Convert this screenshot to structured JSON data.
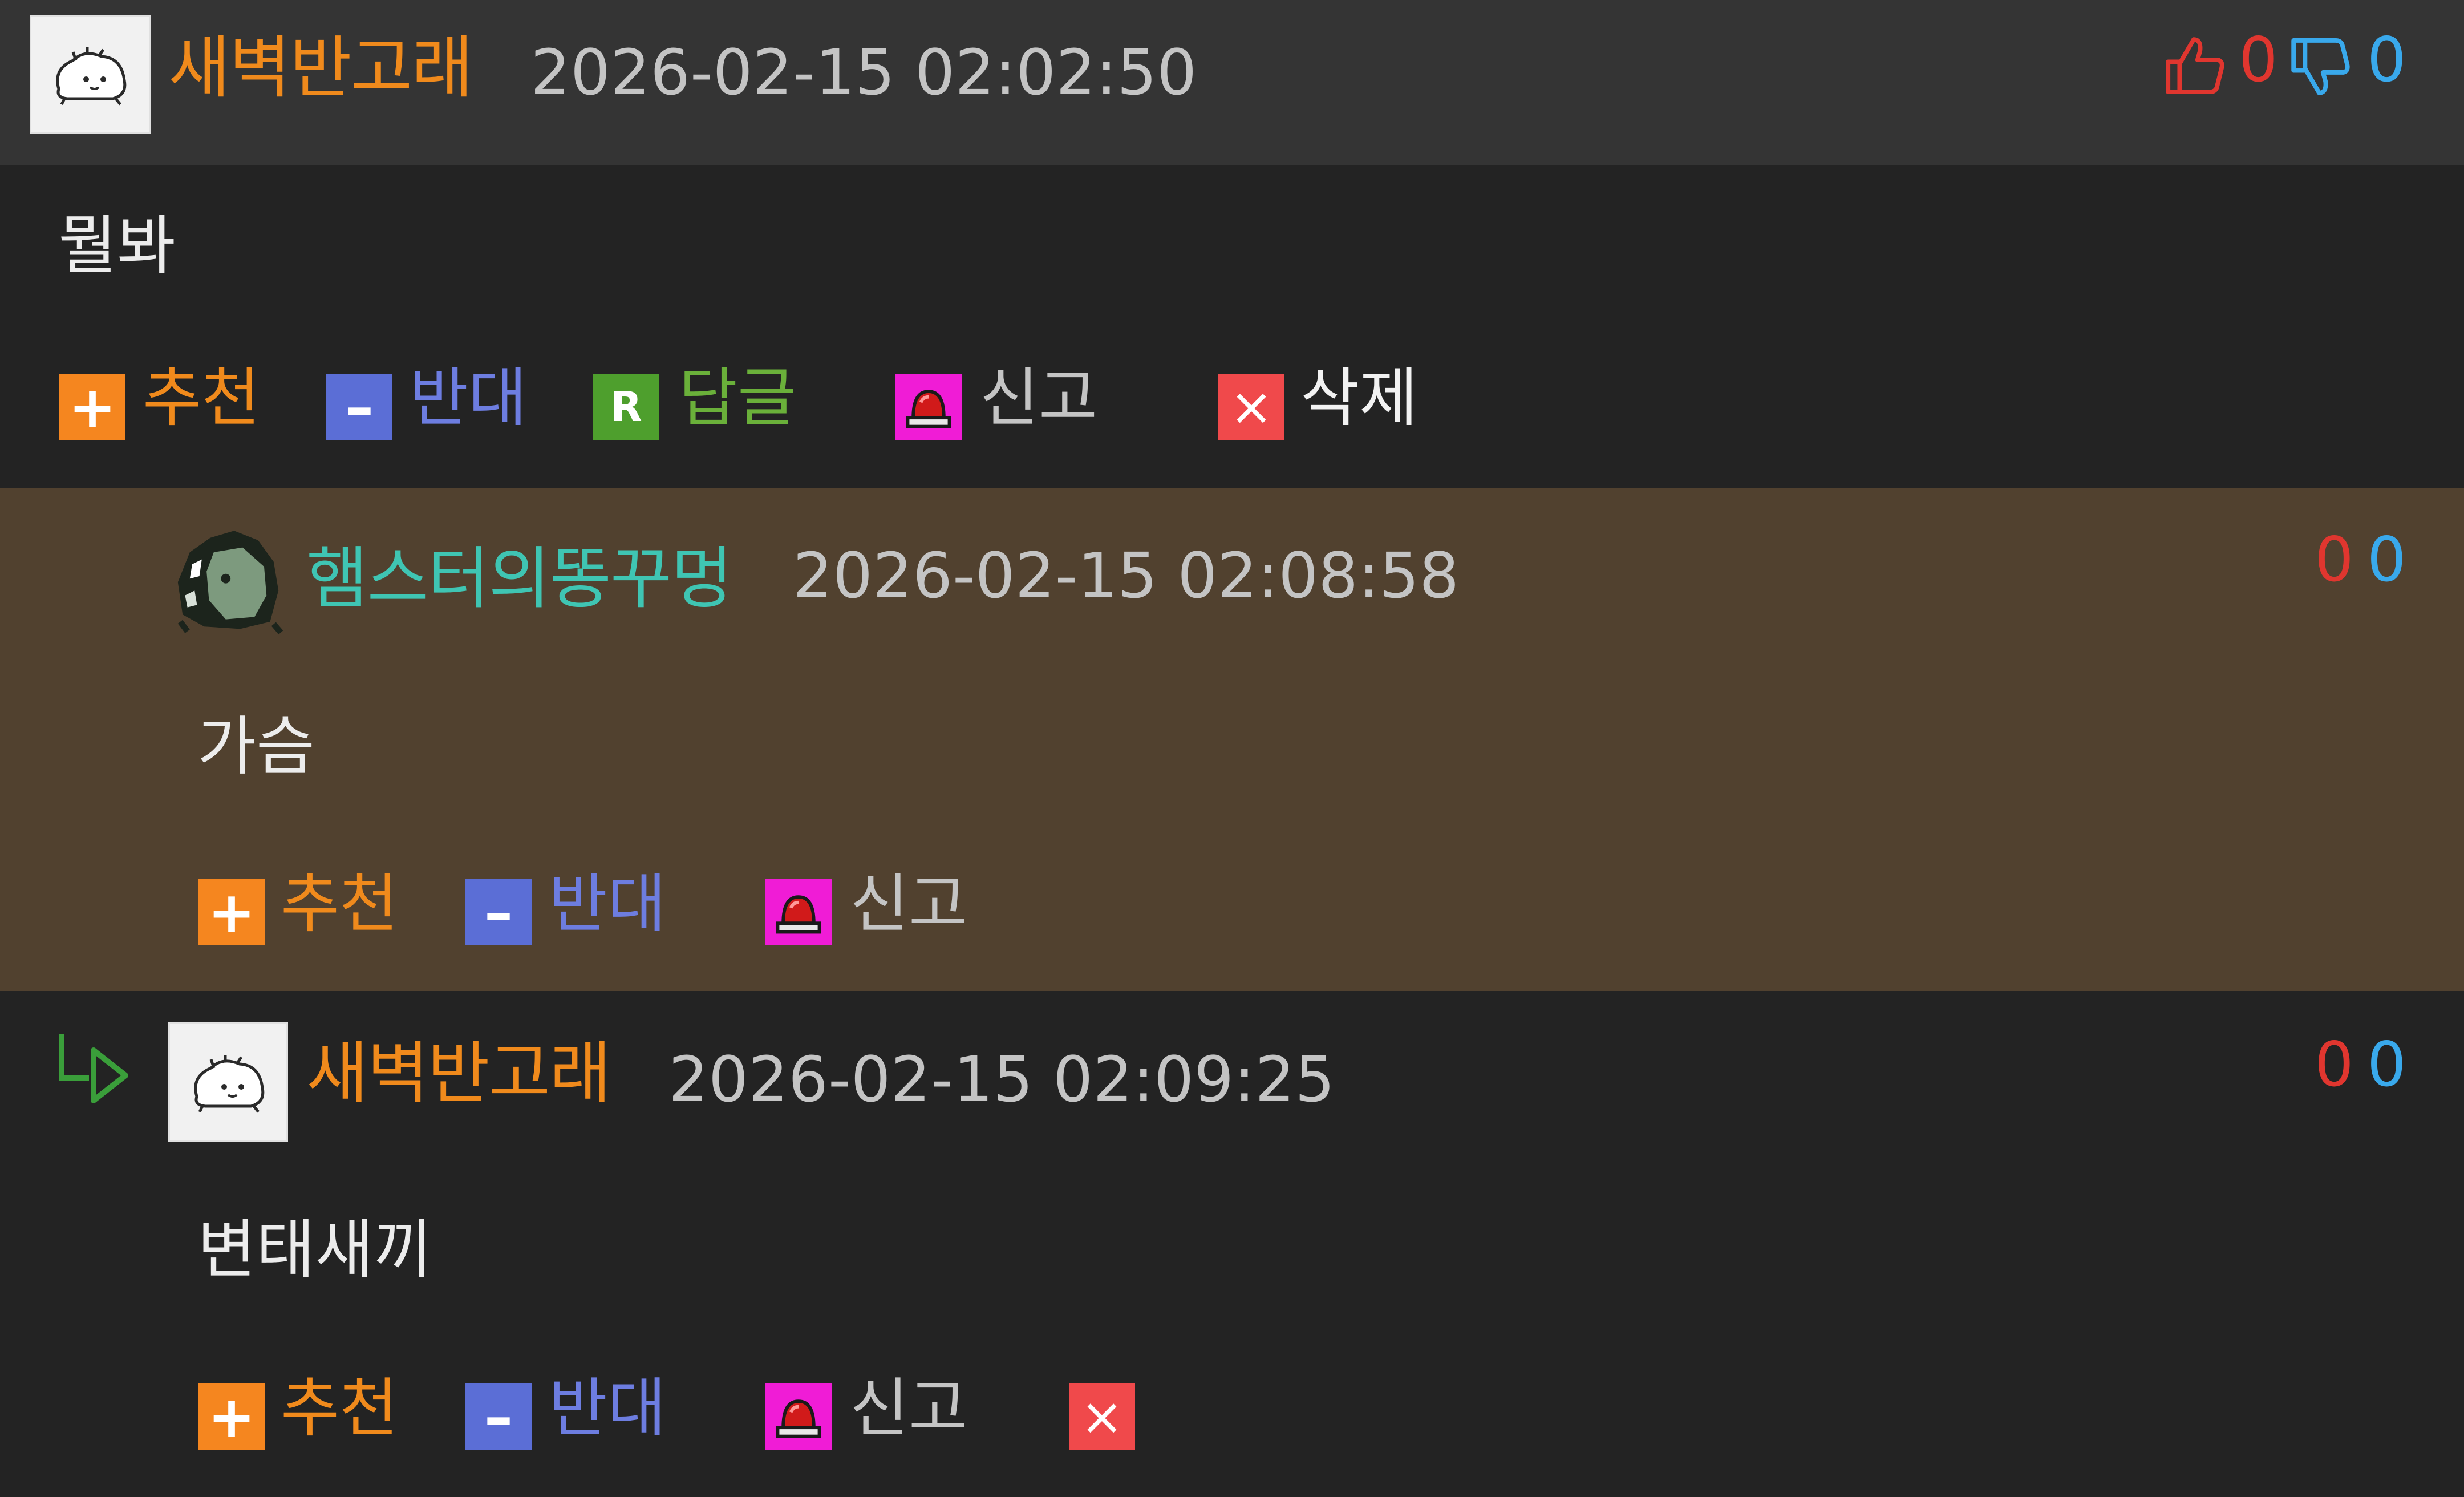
{
  "comments": [
    {
      "nickname": "새벽반고래",
      "timestamp": "2026-02-15 02:02:50",
      "upvotes": "0",
      "downvotes": "0",
      "content": "뭘봐",
      "actions": {
        "recommend": "추천",
        "oppose": "반대",
        "reply": "답글",
        "reply_badge": "R",
        "report": "신고",
        "delete": "삭제"
      }
    },
    {
      "nickname": "햄스터의똥꾸멍",
      "timestamp": "2026-02-15 02:08:58",
      "upvotes": "0",
      "downvotes": "0",
      "content": "가슴",
      "actions": {
        "recommend": "추천",
        "oppose": "반대",
        "report": "신고"
      }
    },
    {
      "nickname": "새벽반고래",
      "timestamp": "2026-02-15 02:09:25",
      "upvotes": "0",
      "downvotes": "0",
      "content": "변태새끼",
      "actions": {
        "recommend": "추천",
        "oppose": "반대",
        "report": "신고"
      }
    }
  ],
  "icons": {
    "plus_glyph": "+",
    "minus_glyph": "–",
    "delete_glyph": "×"
  },
  "colors": {
    "header_bg": "#343434",
    "body_bg": "#232323",
    "highlight_bg": "#51412f",
    "nick_orange": "#f08a1c",
    "nick_teal": "#3fc5b3",
    "upvote_red": "#e0362f",
    "downvote_blue": "#39a9ec"
  }
}
